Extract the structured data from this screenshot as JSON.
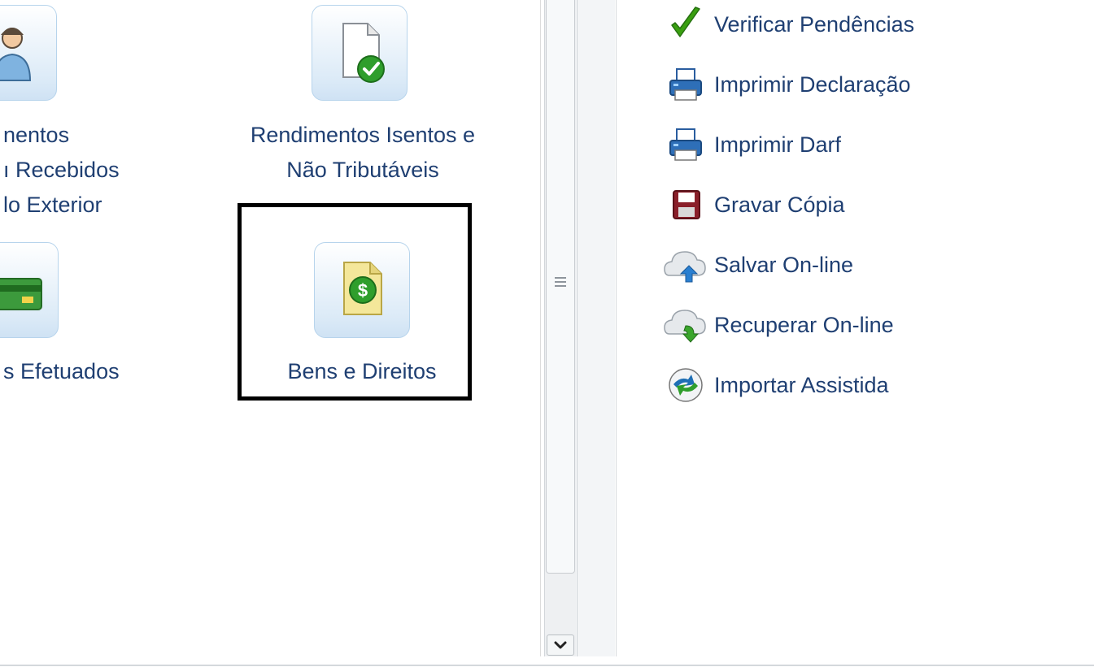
{
  "left_grid": {
    "row1": {
      "tile_left": {
        "label_lines": [
          "nentos",
          "ı Recebidos",
          "lo Exterior"
        ]
      },
      "tile_right": {
        "label_lines": [
          "Rendimentos Isentos e",
          "Não Tributáveis"
        ]
      }
    },
    "row2": {
      "tile_left": {
        "label": "s Efetuados"
      },
      "tile_right": {
        "label": "Bens e Direitos"
      }
    }
  },
  "menu": {
    "items": [
      {
        "label": "Verificar Pendências",
        "icon": "check-icon"
      },
      {
        "label": "Imprimir Declaração",
        "icon": "printer-icon"
      },
      {
        "label": "Imprimir Darf",
        "icon": "printer-icon"
      },
      {
        "label": "Gravar Cópia",
        "icon": "floppy-disk-icon"
      },
      {
        "label": "Salvar On-line",
        "icon": "cloud-upload-icon"
      },
      {
        "label": "Recuperar On-line",
        "icon": "cloud-download-icon"
      },
      {
        "label": "Importar Assistida",
        "icon": "import-assisted-icon"
      }
    ]
  },
  "colors": {
    "text": "#1f3f72",
    "highlight_border": "#000000",
    "tile_border": "#b7d4ec",
    "check_green": "#3aa010"
  }
}
